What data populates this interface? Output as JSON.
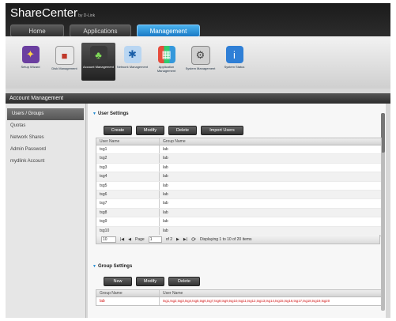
{
  "header": {
    "brand": "ShareCenter",
    "brand_suffix": "by D-Link",
    "tabs": [
      {
        "label": "Home",
        "active": false
      },
      {
        "label": "Applications",
        "active": false
      },
      {
        "label": "Management",
        "active": true
      }
    ]
  },
  "iconbar": {
    "items": [
      {
        "label": "Setup Wizard",
        "icon": "wizard-icon",
        "selected": false
      },
      {
        "label": "Disk Management",
        "icon": "disk-icon",
        "selected": false
      },
      {
        "label": "Account Management",
        "icon": "account-icon",
        "selected": true
      },
      {
        "label": "Network Management",
        "icon": "network-icon",
        "selected": false
      },
      {
        "label": "Application Management",
        "icon": "application-icon",
        "selected": false
      },
      {
        "label": "System Management",
        "icon": "system-icon",
        "selected": false
      },
      {
        "label": "System Status",
        "icon": "status-icon",
        "selected": false
      }
    ]
  },
  "section": {
    "title": "Account Management"
  },
  "sidebar": {
    "items": [
      {
        "label": "Users / Groups",
        "active": true
      },
      {
        "label": "Quotas",
        "active": false
      },
      {
        "label": "Network Shares",
        "active": false
      },
      {
        "label": "Admin Password",
        "active": false
      },
      {
        "label": "mydlink Account",
        "active": false
      }
    ]
  },
  "user_settings": {
    "title": "User Settings",
    "buttons": [
      "Create",
      "Modify",
      "Delete",
      "Import Users"
    ],
    "columns": [
      "User Name",
      "Group Name"
    ],
    "rows": [
      {
        "user": "tsg1",
        "group": "lab"
      },
      {
        "user": "tsg2",
        "group": "lab"
      },
      {
        "user": "tsg3",
        "group": "lab"
      },
      {
        "user": "tsg4",
        "group": "lab"
      },
      {
        "user": "tsg5",
        "group": "lab"
      },
      {
        "user": "tsg6",
        "group": "lab"
      },
      {
        "user": "tsg7",
        "group": "lab"
      },
      {
        "user": "tsg8",
        "group": "lab"
      },
      {
        "user": "tsg9",
        "group": "lab"
      },
      {
        "user": "tsg10",
        "group": "lab"
      }
    ],
    "pager": {
      "page_size": "10",
      "page_label": "Page",
      "page": "1",
      "of_label": "of 2",
      "status": "Displaying 1 to 10 of 20 items"
    }
  },
  "group_settings": {
    "title": "Group Settings",
    "buttons": [
      "New",
      "Modify",
      "Delete"
    ],
    "columns": [
      "Group Name",
      "User Name"
    ],
    "rows": [
      {
        "group": "lab",
        "users": "tsg1,tsg2,tsg3,tsg4,tsg5,tsg6,tsg7,tsg8,tsg9,tsg10,tsg11,tsg12,tsg13,tsg14,tsg15,tsg16,tsg17,tsg18,tsg19,tsg20"
      }
    ]
  },
  "colors": {
    "accent": "#1a79c4",
    "highlight_text": "#d21414"
  }
}
